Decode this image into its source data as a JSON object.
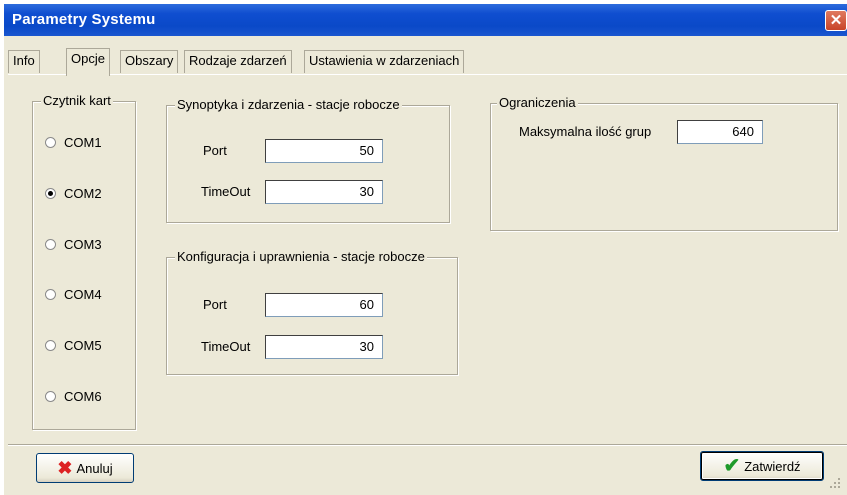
{
  "window": {
    "title": "Parametry Systemu"
  },
  "tabs": [
    "Info",
    "Opcje",
    "Obszary",
    "Rodzaje zdarzeń",
    "Ustawienia w zdarzeniach"
  ],
  "active_tab": "Opcje",
  "card_reader": {
    "legend": "Czytnik kart",
    "options": [
      "COM1",
      "COM2",
      "COM3",
      "COM4",
      "COM5",
      "COM6"
    ],
    "selected": "COM2"
  },
  "synoptics": {
    "legend": "Synoptyka i zdarzenia - stacje robocze",
    "port_label": "Port",
    "port_value": "50",
    "timeout_label": "TimeOut",
    "timeout_value": "30"
  },
  "config": {
    "legend": "Konfiguracja i uprawnienia - stacje robocze",
    "port_label": "Port",
    "port_value": "60",
    "timeout_label": "TimeOut",
    "timeout_value": "30"
  },
  "limits": {
    "legend": "Ograniczenia",
    "max_groups_label": "Maksymalna ilość grup",
    "max_groups_value": "640"
  },
  "buttons": {
    "cancel": "Anuluj",
    "confirm": "Zatwierdź"
  }
}
